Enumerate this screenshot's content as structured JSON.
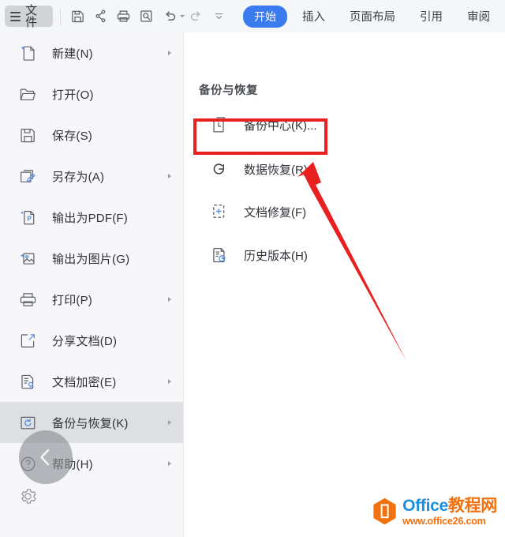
{
  "app": {
    "file_button_label": "文件",
    "accent_color": "#3a7bf0",
    "highlight_color": "#e8201f"
  },
  "toolbar": {
    "icons": [
      {
        "name": "save-icon",
        "label": "保存"
      },
      {
        "name": "quick-share-icon",
        "label": "快速分享"
      },
      {
        "name": "print-icon",
        "label": "打印"
      },
      {
        "name": "print-preview-icon",
        "label": "打印预览"
      },
      {
        "name": "undo-icon",
        "label": "撤销"
      },
      {
        "name": "redo-icon",
        "label": "恢复"
      },
      {
        "name": "customize-toolbar-icon",
        "label": "自定义快速访问工具栏"
      }
    ]
  },
  "tabs": [
    {
      "label": "开始",
      "active": true
    },
    {
      "label": "插入",
      "active": false
    },
    {
      "label": "页面布局",
      "active": false
    },
    {
      "label": "引用",
      "active": false
    },
    {
      "label": "审阅",
      "active": false
    }
  ],
  "sidebar": {
    "items": [
      {
        "label": "新建(N)",
        "icon": "new-document-icon",
        "arrow": true,
        "selected": false
      },
      {
        "label": "打开(O)",
        "icon": "open-folder-icon",
        "arrow": false,
        "selected": false
      },
      {
        "label": "保存(S)",
        "icon": "save-disk-icon",
        "arrow": false,
        "selected": false
      },
      {
        "label": "另存为(A)",
        "icon": "save-as-icon",
        "arrow": true,
        "selected": false
      },
      {
        "label": "输出为PDF(F)",
        "icon": "export-pdf-icon",
        "arrow": false,
        "selected": false
      },
      {
        "label": "输出为图片(G)",
        "icon": "export-image-icon",
        "arrow": false,
        "selected": false
      },
      {
        "label": "打印(P)",
        "icon": "printer-icon",
        "arrow": true,
        "selected": false
      },
      {
        "label": "分享文档(D)",
        "icon": "share-document-icon",
        "arrow": false,
        "selected": false
      },
      {
        "label": "文档加密(E)",
        "icon": "encrypt-document-icon",
        "arrow": true,
        "selected": false
      },
      {
        "label": "备份与恢复(K)",
        "icon": "backup-restore-icon",
        "arrow": true,
        "selected": true
      },
      {
        "label": "帮助(H)",
        "icon": "help-icon",
        "arrow": true,
        "selected": false
      }
    ],
    "collapse_icon": "chevron-left-icon"
  },
  "panel": {
    "title": "备份与恢复",
    "items": [
      {
        "label": "备份中心(K)...",
        "icon": "backup-center-icon",
        "highlighted": false
      },
      {
        "label": "数据恢复(R)",
        "icon": "data-recovery-icon",
        "highlighted": true
      },
      {
        "label": "文档修复(F)",
        "icon": "document-repair-icon",
        "highlighted": false
      },
      {
        "label": "历史版本(H)",
        "icon": "history-version-icon",
        "highlighted": false
      }
    ]
  },
  "annotations": {
    "highlight_target": "数据恢复(R)",
    "arrow_color": "#e8201f"
  },
  "watermark": {
    "brand_en": "Office",
    "brand_cn": "教程网",
    "url": "www.office26.com"
  }
}
